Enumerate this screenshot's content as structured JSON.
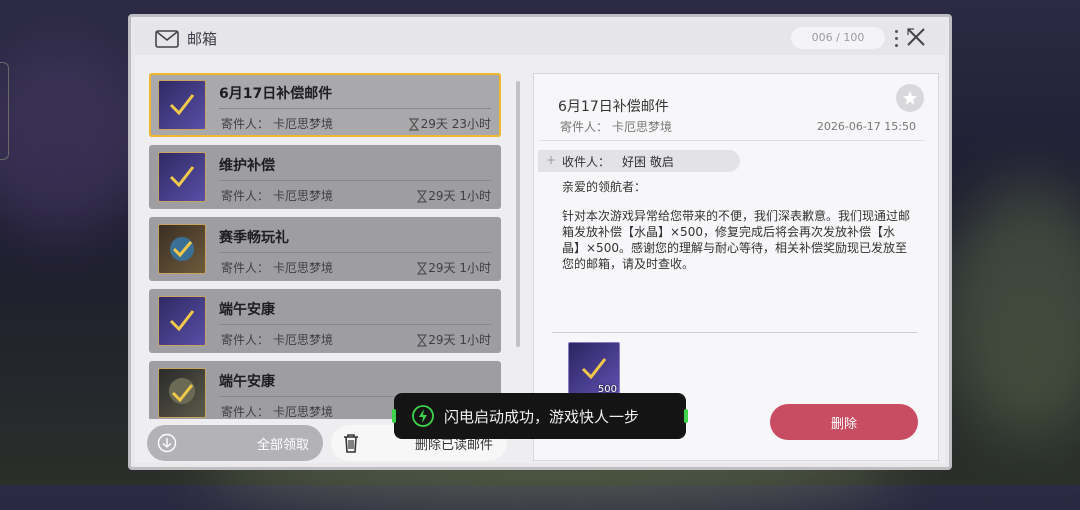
{
  "window": {
    "title": "邮箱",
    "counter": "006 / 100"
  },
  "mails": [
    {
      "name": "6月17日补偿邮件",
      "sender_label": "寄件人：",
      "sender": "卡厄思梦境",
      "time": "29天 23小时",
      "selected": true
    },
    {
      "name": "维护补偿",
      "sender_label": "寄件人：",
      "sender": "卡厄思梦境",
      "time": "29天 1小时",
      "selected": false
    },
    {
      "name": "赛季畅玩礼",
      "sender_label": "寄件人：",
      "sender": "卡厄思梦境",
      "time": "29天 1小时",
      "selected": false
    },
    {
      "name": "端午安康",
      "sender_label": "寄件人：",
      "sender": "卡厄思梦境",
      "time": "29天 1小时",
      "selected": false
    },
    {
      "name": "端午安康",
      "sender_label": "寄件人：",
      "sender": "卡厄思梦境",
      "time": "",
      "selected": false
    }
  ],
  "buttons": {
    "claim_all": "全部领取",
    "delete_read": "删除已读邮件",
    "delete": "删除"
  },
  "detail": {
    "title": "6月17日补偿邮件",
    "sender_label": "寄件人：",
    "sender": "卡厄思梦境",
    "date": "2026-06-17 15:50",
    "recipient_label": "收件人：",
    "recipient": "好困 敬启",
    "greeting": "亲爱的领航者：",
    "body": "针对本次游戏异常给您带来的不便，我们深表歉意。我们现通过邮箱发放补偿【水晶】×500，修复完成后将会再次发放补偿【水晶】×500。感谢您的理解与耐心等待，相关补偿奖励现已发放至您的邮箱，请及时查收。",
    "reward_count": "500"
  },
  "toast": {
    "text": "闪电启动成功，游戏快人一步"
  },
  "colors": {
    "accent_select": "#f0b62e",
    "delete_button": "#c84c62",
    "toast_accent": "#3fd34a"
  }
}
